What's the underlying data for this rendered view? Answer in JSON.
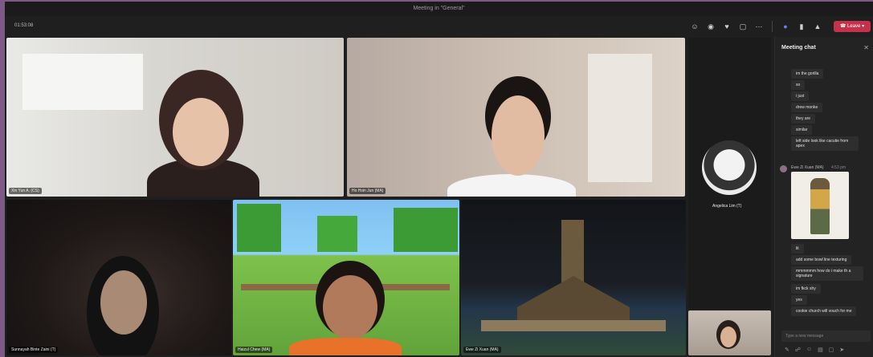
{
  "window": {
    "title": "Meeting in \"General\""
  },
  "toolbar": {
    "timer": "01:53:08",
    "leave_label": "Leave",
    "icons": [
      "people-icon",
      "chat-icon",
      "reactions-icon",
      "rooms-icon",
      "more-icon",
      "camera-icon",
      "mic-icon",
      "share-icon"
    ]
  },
  "participants": [
    {
      "name": "Xin Yun A. (CS)"
    },
    {
      "name": "Ho Hsin Jun (MA)"
    },
    {
      "name": "Angelica Lim (T)"
    },
    {
      "name": "Sunnayah Binte Zaini (T)"
    },
    {
      "name": "Haizul Chew (MA)"
    },
    {
      "name": "Ewe Zi Xuan (MA)"
    }
  ],
  "chat": {
    "title": "Meeting chat",
    "messages_top": [
      "im the gorilla",
      "so",
      "i just",
      "drew monke",
      "they are",
      "similar",
      "left side look like cacutie from apex"
    ],
    "sender": {
      "name": "Ewe Zi Xuan (MA)",
      "time": "4:53 pm"
    },
    "messages_bottom": [
      "lit",
      "add some bowl line texturing",
      "mmmmmm how do i make th a signature",
      "im fkck shy",
      "yes",
      "cookie church will vouch for me"
    ],
    "composer_placeholder": "Type a new message"
  }
}
